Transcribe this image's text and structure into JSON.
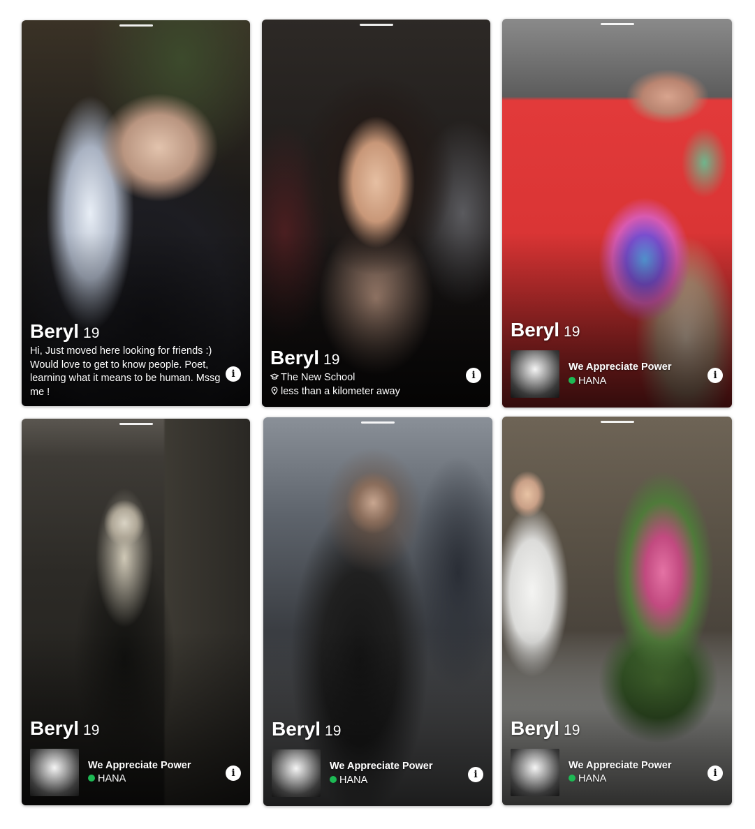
{
  "colors": {
    "spotify_green": "#1db954",
    "card_text": "#ffffff"
  },
  "cards": [
    {
      "name": "Beryl",
      "age": "19",
      "bio": "Hi, Just moved here looking for friends :) Would love to get to know people. Poet, learning what it means to be human. Mssg me !",
      "info_icon": "info-icon"
    },
    {
      "name": "Beryl",
      "age": "19",
      "school": "The New School",
      "school_icon": "graduation-cap-icon",
      "distance": "less than a kilometer away",
      "distance_icon": "location-pin-icon",
      "info_icon": "info-icon"
    },
    {
      "name": "Beryl",
      "age": "19",
      "anthem_title": "We Appreciate Power",
      "anthem_artist": "HANA",
      "anthem_icon": "spotify-icon",
      "info_icon": "info-icon"
    },
    {
      "name": "Beryl",
      "age": "19",
      "anthem_title": "We Appreciate Power",
      "anthem_artist": "HANA",
      "anthem_icon": "spotify-icon",
      "info_icon": "info-icon"
    },
    {
      "name": "Beryl",
      "age": "19",
      "anthem_title": "We Appreciate Power",
      "anthem_artist": "HANA",
      "anthem_icon": "spotify-icon",
      "info_icon": "info-icon"
    },
    {
      "name": "Beryl",
      "age": "19",
      "anthem_title": "We Appreciate Power",
      "anthem_artist": "HANA",
      "anthem_icon": "spotify-icon",
      "info_icon": "info-icon"
    }
  ]
}
